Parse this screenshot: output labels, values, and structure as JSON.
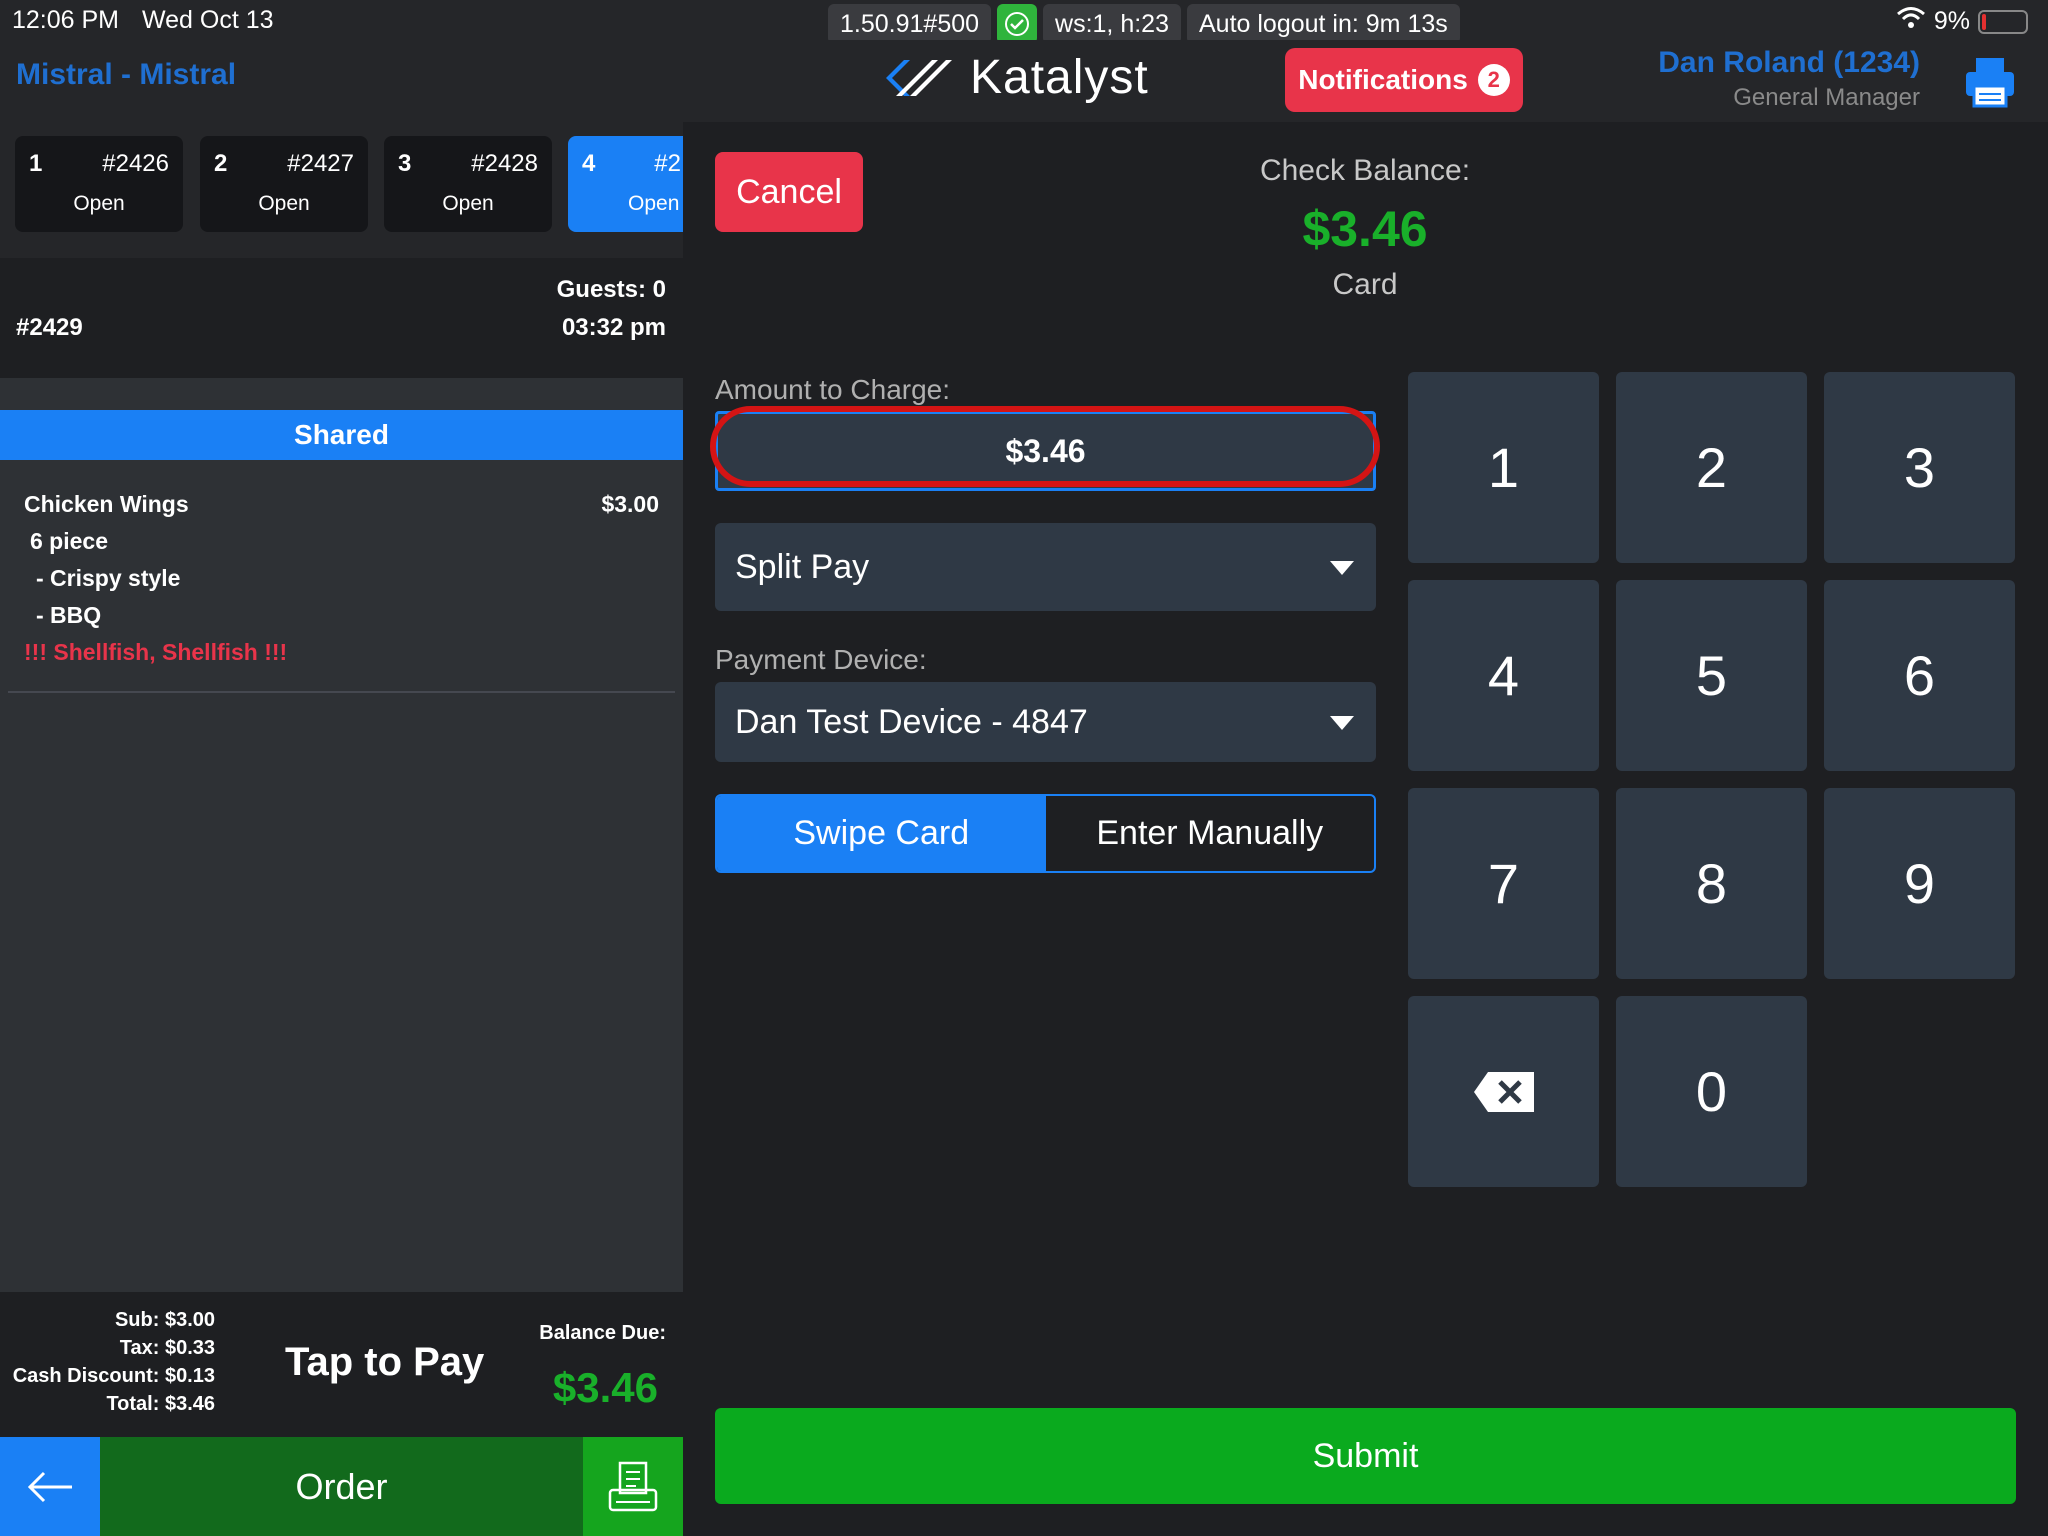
{
  "status_bar": {
    "time": "12:06 PM",
    "date": "Wed Oct 13",
    "version": "1.50.91#500",
    "ws": "ws:1, h:23",
    "auto_logout": "Auto logout in: 9m 13s",
    "battery": "9%"
  },
  "header": {
    "location": "Mistral - Mistral",
    "logo_text": "Katalyst",
    "notifications_label": "Notifications",
    "notifications_count": "2",
    "user_name": "Dan Roland (1234)",
    "user_role": "General Manager"
  },
  "check_tabs": [
    {
      "num": "1",
      "check": "#2426",
      "status": "Open"
    },
    {
      "num": "2",
      "check": "#2427",
      "status": "Open"
    },
    {
      "num": "3",
      "check": "#2428",
      "status": "Open"
    },
    {
      "num": "4",
      "check": "#2",
      "status": "Open"
    }
  ],
  "check": {
    "guests": "Guests: 0",
    "time": "03:32 pm",
    "id": "#2429",
    "seat_label": "Shared"
  },
  "item": {
    "name": "Chicken Wings",
    "price": "$3.00",
    "size": "6 piece",
    "mod1": "- Crispy style",
    "mod2": "- BBQ",
    "allergy": "!!! Shellfish, Shellfish !!!"
  },
  "totals": {
    "sub": "Sub: $3.00",
    "tax": "Tax: $0.33",
    "cash_discount": "Cash Discount: $0.13",
    "total": "Total: $3.46",
    "tap_to_pay": "Tap to Pay",
    "balance_label": "Balance Due:",
    "balance_value": "$3.46"
  },
  "bottom": {
    "order_label": "Order"
  },
  "payment": {
    "cancel_label": "Cancel",
    "check_balance_label": "Check Balance:",
    "check_balance_value": "$3.46",
    "payment_type": "Card",
    "amount_label": "Amount to Charge:",
    "amount_value": "$3.46",
    "split_pay_value": "Split Pay",
    "device_label": "Payment Device:",
    "device_value": "Dan Test Device - 4847",
    "swipe_label": "Swipe Card",
    "manual_label": "Enter Manually",
    "submit_label": "Submit"
  },
  "keypad": {
    "k1": "1",
    "k2": "2",
    "k3": "3",
    "k4": "4",
    "k5": "5",
    "k6": "6",
    "k7": "7",
    "k8": "8",
    "k9": "9",
    "k0": "0"
  },
  "colors": {
    "accent_blue": "#1a80f5",
    "danger_red": "#e8344a",
    "success_green": "#19b02a"
  }
}
